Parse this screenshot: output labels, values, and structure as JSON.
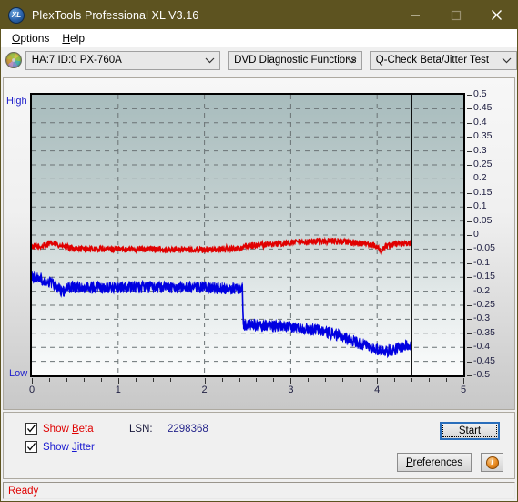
{
  "window": {
    "title": "PlexTools Professional XL V3.16",
    "icon": "XL",
    "icon_name": "plextools-logo-icon",
    "minimize": "—",
    "maximize": "□",
    "close": "×"
  },
  "menubar": {
    "items": [
      {
        "label": "Options",
        "accel": "O"
      },
      {
        "label": "Help",
        "accel": "H"
      }
    ]
  },
  "toolbar": {
    "disc_icon": "disc-icon",
    "drive_select": {
      "value": "HA:7 ID:0  PX-760A",
      "options": [
        "HA:7 ID:0  PX-760A"
      ]
    },
    "function_select": {
      "value": "DVD Diagnostic Functions",
      "options": [
        "DVD Diagnostic Functions"
      ]
    },
    "test_select": {
      "value": "Q-Check Beta/Jitter Test",
      "options": [
        "Q-Check Beta/Jitter Test"
      ]
    }
  },
  "controls": {
    "show_beta": {
      "label_pre": "Show ",
      "label_accel": "B",
      "label_post": "eta",
      "checked": true,
      "color": "#e00000"
    },
    "show_jitter": {
      "label_pre": "Show ",
      "label_accel": "J",
      "label_post": "itter",
      "checked": true,
      "color": "#1818d0"
    },
    "lsn_label": "LSN:",
    "lsn_value": "2298368",
    "start_button": {
      "pre": "",
      "accel": "S",
      "post": "tart",
      "focused": true
    },
    "preferences_button": {
      "pre": "",
      "accel": "P",
      "post": "references"
    },
    "info_button": {
      "glyph": "i"
    }
  },
  "statusbar": {
    "text": "Ready"
  },
  "chart_data": {
    "type": "line",
    "title": "Q-Check Beta/Jitter Test",
    "xlabel": "",
    "ylabel": "",
    "xlim": [
      0,
      5
    ],
    "ylim": [
      -0.5,
      0.5
    ],
    "grid": true,
    "legend_position": "below-plot",
    "axis_left_label_top": "High",
    "axis_left_label_bottom": "Low",
    "xticks": [
      0,
      1,
      2,
      3,
      4,
      5
    ],
    "xtick_labels": [
      "0",
      "1",
      "2",
      "3",
      "4",
      "5"
    ],
    "yticks": [
      0.5,
      0.45,
      0.4,
      0.35,
      0.3,
      0.25,
      0.2,
      0.15,
      0.1,
      0.05,
      0,
      -0.05,
      -0.1,
      -0.15,
      -0.2,
      -0.25,
      -0.3,
      -0.35,
      -0.4,
      -0.45,
      -0.5
    ],
    "ytick_labels": [
      "0.5",
      "0.45",
      "0.4",
      "0.35",
      "0.3",
      "0.25",
      "0.2",
      "0.15",
      "0.1",
      "0.05",
      "0",
      "-0.05",
      "-0.1",
      "-0.15",
      "-0.2",
      "-0.25",
      "-0.3",
      "-0.35",
      "-0.4",
      "-0.45",
      "-0.5"
    ],
    "data_end_marker_x": 4.4,
    "plot_bg_gradient": [
      "#a8bcbd",
      "#fbfcfc"
    ],
    "series": [
      {
        "name": "Beta",
        "color": "#e00000",
        "x": [
          0.0,
          0.1,
          0.2,
          0.3,
          0.4,
          0.5,
          0.6,
          0.7,
          0.8,
          0.9,
          1.0,
          1.1,
          1.2,
          1.3,
          1.4,
          1.5,
          1.6,
          1.7,
          1.8,
          1.9,
          2.0,
          2.1,
          2.2,
          2.3,
          2.4,
          2.45,
          2.5,
          2.6,
          2.7,
          2.8,
          2.9,
          3.0,
          3.1,
          3.2,
          3.3,
          3.4,
          3.5,
          3.6,
          3.7,
          3.8,
          3.9,
          4.0,
          4.05,
          4.1,
          4.2,
          4.3,
          4.4
        ],
        "values": [
          -0.04,
          -0.042,
          -0.03,
          -0.034,
          -0.044,
          -0.048,
          -0.05,
          -0.05,
          -0.05,
          -0.05,
          -0.05,
          -0.05,
          -0.05,
          -0.05,
          -0.05,
          -0.052,
          -0.052,
          -0.052,
          -0.052,
          -0.052,
          -0.052,
          -0.052,
          -0.05,
          -0.048,
          -0.048,
          -0.042,
          -0.038,
          -0.036,
          -0.034,
          -0.032,
          -0.03,
          -0.028,
          -0.026,
          -0.024,
          -0.022,
          -0.022,
          -0.022,
          -0.024,
          -0.026,
          -0.03,
          -0.034,
          -0.04,
          -0.058,
          -0.04,
          -0.032,
          -0.03,
          -0.03
        ],
        "noise": 0.012
      },
      {
        "name": "Jitter",
        "color": "#0000e0",
        "x": [
          0.0,
          0.1,
          0.2,
          0.3,
          0.35,
          0.4,
          0.45,
          0.5,
          0.6,
          0.7,
          0.8,
          0.9,
          1.0,
          1.1,
          1.2,
          1.3,
          1.4,
          1.5,
          1.6,
          1.7,
          1.8,
          1.9,
          2.0,
          2.1,
          2.2,
          2.3,
          2.4,
          2.44,
          2.45,
          2.5,
          2.6,
          2.7,
          2.8,
          2.9,
          3.0,
          3.1,
          3.2,
          3.3,
          3.4,
          3.5,
          3.6,
          3.7,
          3.8,
          3.9,
          4.0,
          4.1,
          4.2,
          4.3,
          4.4
        ],
        "values": [
          -0.148,
          -0.155,
          -0.168,
          -0.185,
          -0.205,
          -0.195,
          -0.185,
          -0.185,
          -0.186,
          -0.186,
          -0.186,
          -0.186,
          -0.186,
          -0.186,
          -0.186,
          -0.186,
          -0.186,
          -0.186,
          -0.186,
          -0.186,
          -0.186,
          -0.186,
          -0.188,
          -0.188,
          -0.188,
          -0.19,
          -0.19,
          -0.19,
          -0.318,
          -0.32,
          -0.322,
          -0.322,
          -0.324,
          -0.326,
          -0.328,
          -0.33,
          -0.334,
          -0.338,
          -0.344,
          -0.352,
          -0.362,
          -0.374,
          -0.386,
          -0.398,
          -0.408,
          -0.412,
          -0.408,
          -0.398,
          -0.386
        ],
        "noise": 0.022
      }
    ]
  }
}
